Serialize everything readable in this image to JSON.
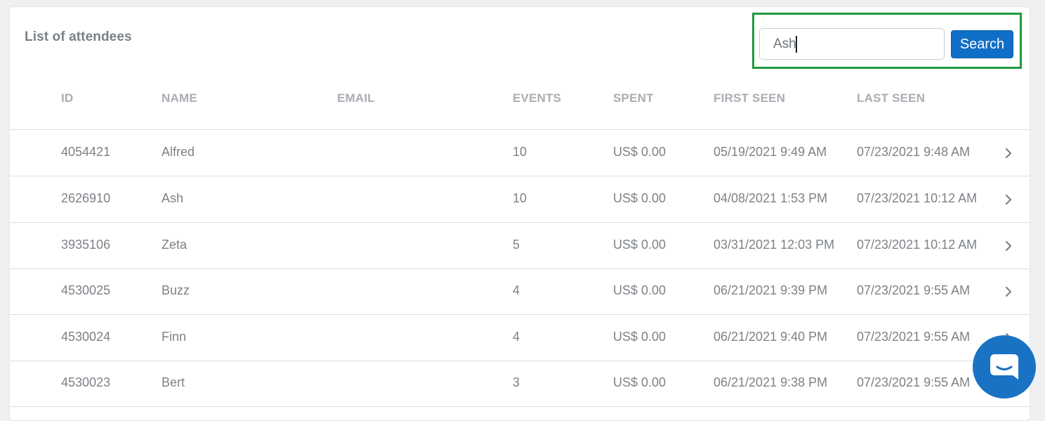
{
  "card": {
    "title": "List of attendees"
  },
  "search": {
    "value": "Ash",
    "button_label": "Search"
  },
  "table": {
    "columns": {
      "id": "ID",
      "name": "NAME",
      "email": "EMAIL",
      "events": "EVENTS",
      "spent": "SPENT",
      "first_seen": "FIRST SEEN",
      "last_seen": "LAST SEEN"
    },
    "rows": [
      {
        "id": "4054421",
        "name": "Alfred",
        "email": "",
        "events": "10",
        "spent": "US$ 0.00",
        "first_seen": "05/19/2021 9:49 AM",
        "last_seen": "07/23/2021 9:48 AM"
      },
      {
        "id": "2626910",
        "name": "Ash",
        "email": "",
        "events": "10",
        "spent": "US$ 0.00",
        "first_seen": "04/08/2021 1:53 PM",
        "last_seen": "07/23/2021 10:12 AM"
      },
      {
        "id": "3935106",
        "name": "Zeta",
        "email": "",
        "events": "5",
        "spent": "US$ 0.00",
        "first_seen": "03/31/2021 12:03 PM",
        "last_seen": "07/23/2021 10:12 AM"
      },
      {
        "id": "4530025",
        "name": "Buzz",
        "email": "",
        "events": "4",
        "spent": "US$ 0.00",
        "first_seen": "06/21/2021 9:39 PM",
        "last_seen": "07/23/2021 9:55 AM"
      },
      {
        "id": "4530024",
        "name": "Finn",
        "email": "",
        "events": "4",
        "spent": "US$ 0.00",
        "first_seen": "06/21/2021 9:40 PM",
        "last_seen": "07/23/2021 9:55 AM"
      },
      {
        "id": "4530023",
        "name": "Bert",
        "email": "",
        "events": "3",
        "spent": "US$ 0.00",
        "first_seen": "06/21/2021 9:38 PM",
        "last_seen": "07/23/2021 9:55 AM"
      }
    ]
  },
  "colors": {
    "accent": "#0f6fc6",
    "highlight": "#1f9a3f",
    "chat": "#1a72c4"
  },
  "icons": {
    "row_action": "chevron-right-icon",
    "chat": "chat-icon"
  }
}
